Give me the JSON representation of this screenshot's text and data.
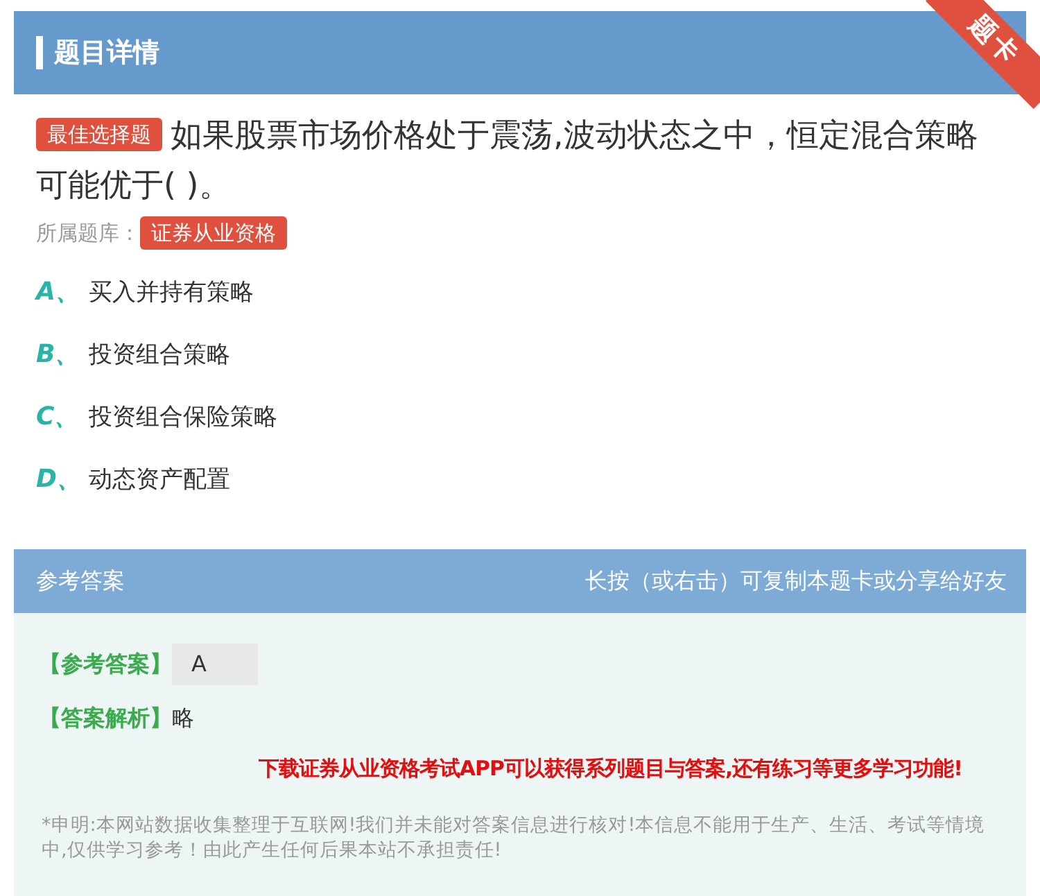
{
  "header": {
    "title": "题目详情",
    "ribbon": "题卡"
  },
  "question": {
    "type_tag": "最佳选择题",
    "text": "如果股票市场价格处于震荡,波动状态之中，恒定混合策略可能优于( )。",
    "bank_label": "所属题库：",
    "bank_tag": "证券从业资格"
  },
  "options": [
    {
      "letter": "A、",
      "text": "买入并持有策略"
    },
    {
      "letter": "B、",
      "text": "投资组合策略"
    },
    {
      "letter": "C、",
      "text": "投资组合保险策略"
    },
    {
      "letter": "D、",
      "text": "动态资产配置"
    }
  ],
  "answer_panel": {
    "title": "参考答案",
    "hint": "长按（或右击）可复制本题卡或分享给好友",
    "answer_label": "【参考答案】",
    "answer": "A",
    "analysis_label": "【答案解析】",
    "analysis": "略",
    "promo": "下载证券从业资格考试APP可以获得系列题目与答案,还有练习等更多学习功能!",
    "disclaimer": "*申明:本网站数据收集整理于互联网!我们并未能对答案信息进行核对!本信息不能用于生产、生活、考试等情境中,仅供学习参考！由此产生任何后果本站不承担责任!"
  }
}
